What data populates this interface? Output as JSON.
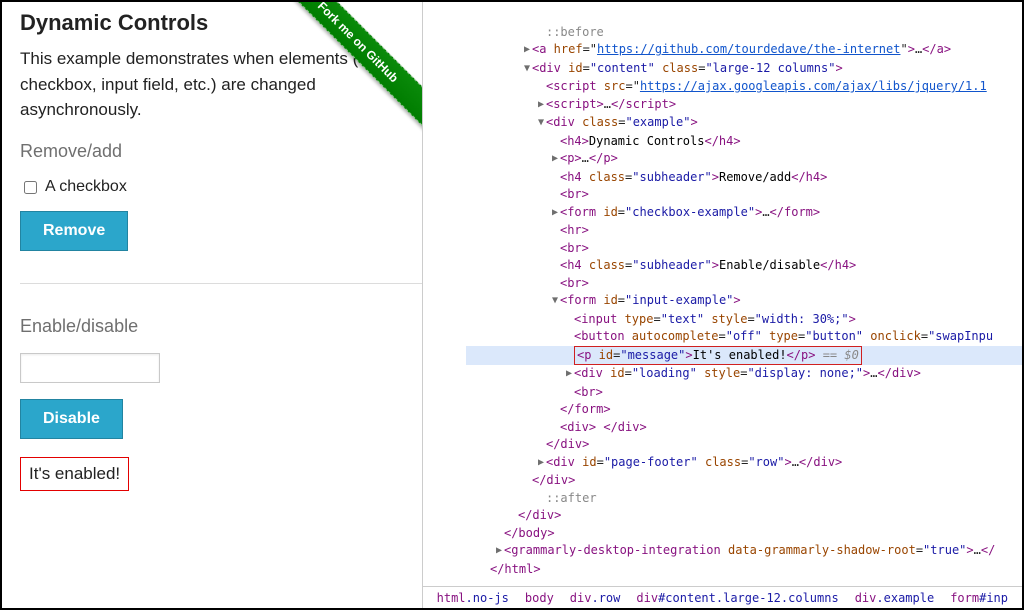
{
  "page": {
    "title": "Dynamic Controls",
    "intro": "This example demonstrates when elements (e.g., checkbox, input field, etc.) are changed asynchronously.",
    "ribbon": "Fork me on GitHub"
  },
  "section_remove": {
    "header": "Remove/add",
    "checkbox_label": "A checkbox",
    "button": "Remove"
  },
  "section_enable": {
    "header": "Enable/disable",
    "input_value": "",
    "button": "Disable",
    "message": "It's enabled!"
  },
  "devtools": {
    "lines": [
      {
        "indent": 5,
        "arrow": "",
        "html": "<span class='pseudo'>::before</span>"
      },
      {
        "indent": 4,
        "arrow": "▶",
        "html": "<span class='tag'>&lt;a</span> <span class='attr-n'>href</span>=\"<span class='link'>https://github.com/tourdedave/the-internet</span>\"<span class='tag'>&gt;</span>…<span class='tag'>&lt;/a&gt;</span>"
      },
      {
        "indent": 4,
        "arrow": "▼",
        "html": "<span class='tag'>&lt;div</span> <span class='attr-n'>id</span>=<span class='attr-v'>\"content\"</span> <span class='attr-n'>class</span>=<span class='attr-v'>\"large-12 columns\"</span><span class='tag'>&gt;</span>"
      },
      {
        "indent": 5,
        "arrow": "",
        "html": "<span class='tag'>&lt;script</span> <span class='attr-n'>src</span>=\"<span class='link'>https://ajax.googleapis.com/ajax/libs/jquery/1.1</span>"
      },
      {
        "indent": 5,
        "arrow": "▶",
        "html": "<span class='tag'>&lt;script&gt;</span>…<span class='tag'>&lt;/script&gt;</span>"
      },
      {
        "indent": 5,
        "arrow": "▼",
        "html": "<span class='tag'>&lt;div</span> <span class='attr-n'>class</span>=<span class='attr-v'>\"example\"</span><span class='tag'>&gt;</span>"
      },
      {
        "indent": 6,
        "arrow": "",
        "html": "<span class='tag'>&lt;h4&gt;</span><span class='text'>Dynamic Controls</span><span class='tag'>&lt;/h4&gt;</span>"
      },
      {
        "indent": 6,
        "arrow": "▶",
        "html": "<span class='tag'>&lt;p&gt;</span>…<span class='tag'>&lt;/p&gt;</span>"
      },
      {
        "indent": 6,
        "arrow": "",
        "html": "<span class='tag'>&lt;h4</span> <span class='attr-n'>class</span>=<span class='attr-v'>\"subheader\"</span><span class='tag'>&gt;</span><span class='text'>Remove/add</span><span class='tag'>&lt;/h4&gt;</span>"
      },
      {
        "indent": 6,
        "arrow": "",
        "html": "<span class='tag'>&lt;br&gt;</span>"
      },
      {
        "indent": 6,
        "arrow": "▶",
        "html": "<span class='tag'>&lt;form</span> <span class='attr-n'>id</span>=<span class='attr-v'>\"checkbox-example\"</span><span class='tag'>&gt;</span>…<span class='tag'>&lt;/form&gt;</span>"
      },
      {
        "indent": 6,
        "arrow": "",
        "html": "<span class='tag'>&lt;hr&gt;</span>"
      },
      {
        "indent": 6,
        "arrow": "",
        "html": "<span class='tag'>&lt;br&gt;</span>"
      },
      {
        "indent": 6,
        "arrow": "",
        "html": "<span class='tag'>&lt;h4</span> <span class='attr-n'>class</span>=<span class='attr-v'>\"subheader\"</span><span class='tag'>&gt;</span><span class='text'>Enable/disable</span><span class='tag'>&lt;/h4&gt;</span>"
      },
      {
        "indent": 6,
        "arrow": "",
        "html": "<span class='tag'>&lt;br&gt;</span>"
      },
      {
        "indent": 6,
        "arrow": "▼",
        "html": "<span class='tag'>&lt;form</span> <span class='attr-n'>id</span>=<span class='attr-v'>\"input-example\"</span><span class='tag'>&gt;</span>"
      },
      {
        "indent": 7,
        "arrow": "",
        "html": "<span class='tag'>&lt;input</span> <span class='attr-n'>type</span>=<span class='attr-v'>\"text\"</span> <span class='attr-n'>style</span>=<span class='attr-v'>\"width: 30%;\"</span><span class='tag'>&gt;</span>"
      },
      {
        "indent": 7,
        "arrow": "",
        "html": "<span class='tag'>&lt;button</span> <span class='attr-n'>autocomplete</span>=<span class='attr-v'>\"off\"</span> <span class='attr-n'>type</span>=<span class='attr-v'>\"button\"</span> <span class='attr-n'>onclick</span>=<span class='attr-v'>\"swapInpu</span>"
      },
      {
        "indent": 7,
        "arrow": "",
        "hl": true,
        "html": "<span class='hlbox'><span class='tag'>&lt;p</span> <span class='attr-n'>id</span>=<span class='attr-v'>\"message\"</span><span class='tag'>&gt;</span><span class='text'>It's enabled!</span><span class='tag'>&lt;/p&gt;</span> <span class='dim'>== $0</span></span>"
      },
      {
        "indent": 7,
        "arrow": "▶",
        "html": "<span class='tag'>&lt;div</span> <span class='attr-n'>id</span>=<span class='attr-v'>\"loading\"</span> <span class='attr-n'>style</span>=<span class='attr-v'>\"display: none;\"</span><span class='tag'>&gt;</span>…<span class='tag'>&lt;/div&gt;</span>"
      },
      {
        "indent": 7,
        "arrow": "",
        "html": "<span class='tag'>&lt;br&gt;</span>"
      },
      {
        "indent": 6,
        "arrow": "",
        "html": "<span class='tag'>&lt;/form&gt;</span>"
      },
      {
        "indent": 6,
        "arrow": "",
        "html": "<span class='tag'>&lt;div&gt;</span> <span class='tag'>&lt;/div&gt;</span>"
      },
      {
        "indent": 5,
        "arrow": "",
        "html": "<span class='tag'>&lt;/div&gt;</span>"
      },
      {
        "indent": 5,
        "arrow": "▶",
        "html": "<span class='tag'>&lt;div</span> <span class='attr-n'>id</span>=<span class='attr-v'>\"page-footer\"</span> <span class='attr-n'>class</span>=<span class='attr-v'>\"row\"</span><span class='tag'>&gt;</span>…<span class='tag'>&lt;/div&gt;</span>"
      },
      {
        "indent": 4,
        "arrow": "",
        "html": "<span class='tag'>&lt;/div&gt;</span>"
      },
      {
        "indent": 5,
        "arrow": "",
        "html": "<span class='pseudo'>::after</span>"
      },
      {
        "indent": 3,
        "arrow": "",
        "html": "<span class='tag'>&lt;/div&gt;</span>"
      },
      {
        "indent": 2,
        "arrow": "",
        "html": "<span class='tag'>&lt;/body&gt;</span>"
      },
      {
        "indent": 2,
        "arrow": "▶",
        "html": "<span class='tag'>&lt;grammarly-desktop-integration</span> <span class='attr-n'>data-grammarly-shadow-root</span>=<span class='attr-v'>\"true\"</span><span class='tag'>&gt;</span>…<span class='tag'>&lt;/</span>"
      },
      {
        "indent": 1,
        "arrow": "",
        "html": "<span class='tag'>&lt;/html&gt;</span>"
      }
    ],
    "crumbs": [
      "html.no-js",
      "body",
      "div.row",
      "div#content.large-12.columns",
      "div.example",
      "form#inp"
    ]
  }
}
